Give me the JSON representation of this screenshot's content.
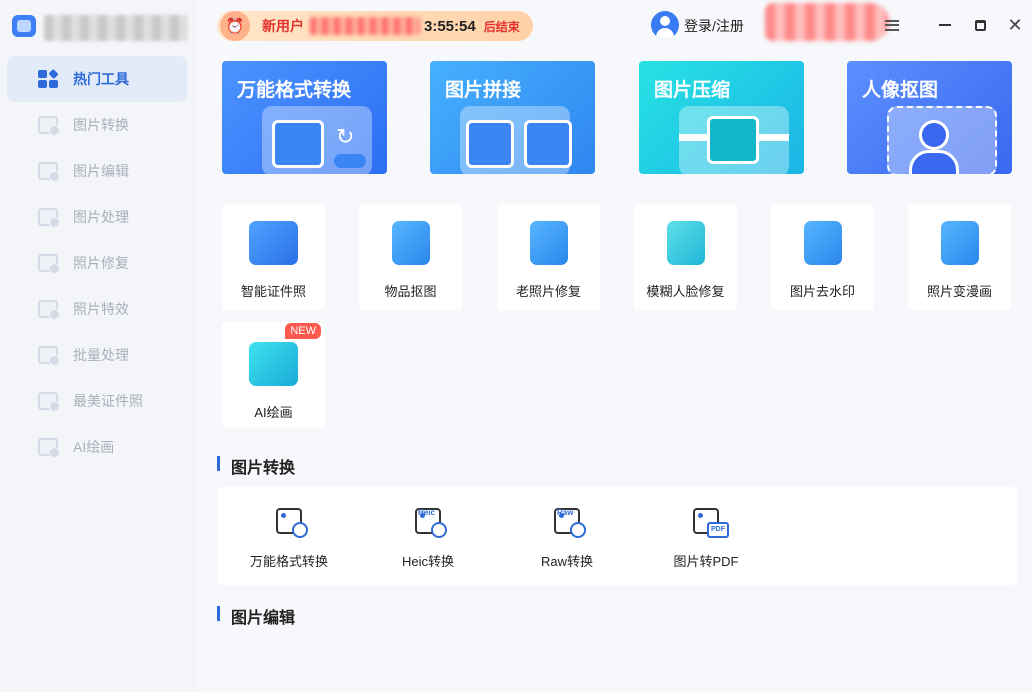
{
  "sidebar": {
    "items": [
      {
        "label": "热门工具",
        "icon": "apps-grid-icon"
      },
      {
        "label": "图片转换",
        "icon": "image-convert-icon"
      },
      {
        "label": "图片编辑",
        "icon": "image-edit-icon"
      },
      {
        "label": "图片处理",
        "icon": "image-process-icon"
      },
      {
        "label": "照片修复",
        "icon": "photo-repair-icon"
      },
      {
        "label": "照片特效",
        "icon": "photo-effect-icon"
      },
      {
        "label": "批量处理",
        "icon": "batch-icon"
      },
      {
        "label": "最美证件照",
        "icon": "id-photo-icon"
      },
      {
        "label": "AI绘画",
        "icon": "ai-paint-icon"
      }
    ],
    "active_index": 0
  },
  "topbar": {
    "promo_label": "新用户",
    "promo_time": "3:55:54",
    "promo_end": "后结束",
    "login_label": "登录/注册"
  },
  "banners": [
    {
      "title": "万能格式转换",
      "color": "#2c6ef3"
    },
    {
      "title": "图片拼接",
      "color": "#2f86f0"
    },
    {
      "title": "图片压缩",
      "color": "#1cb4e6"
    },
    {
      "title": "人像抠图",
      "color": "#3a68f0"
    }
  ],
  "tools": [
    {
      "label": "智能证件照",
      "icon": "id-card-icon"
    },
    {
      "label": "物品抠图",
      "icon": "shopping-bag-icon"
    },
    {
      "label": "老照片修复",
      "icon": "wrench-photo-icon"
    },
    {
      "label": "模糊人脸修复",
      "icon": "face-repair-icon"
    },
    {
      "label": "图片去水印",
      "icon": "eraser-icon"
    },
    {
      "label": "照片变漫画",
      "icon": "cartoon-bear-icon"
    },
    {
      "label": "AI绘画",
      "icon": "ai-drawing-icon",
      "badge": "NEW"
    }
  ],
  "sections": {
    "convert_title": "图片转换",
    "edit_title": "图片编辑"
  },
  "convert_items": [
    {
      "label": "万能格式转换",
      "tag": ""
    },
    {
      "label": "Heic转换",
      "tag": "Heic"
    },
    {
      "label": "Raw转换",
      "tag": "Raw"
    },
    {
      "label": "图片转PDF",
      "tag": "PDF"
    }
  ]
}
